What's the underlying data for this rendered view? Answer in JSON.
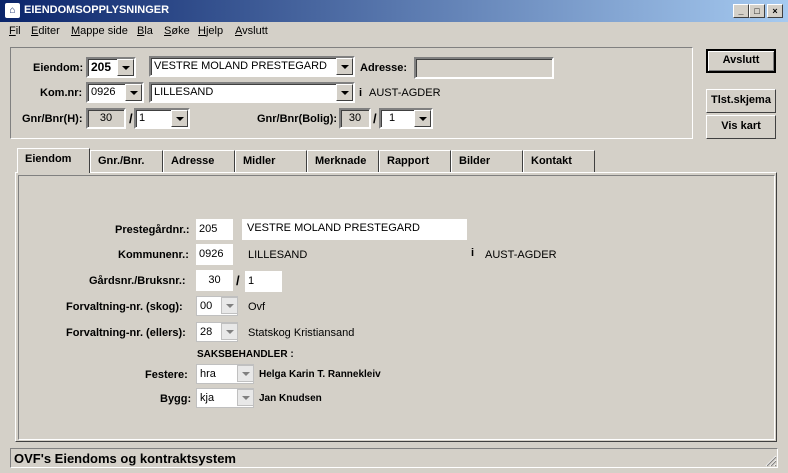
{
  "window": {
    "title": "EIENDOMSOPPLYSNINGER",
    "min_glyph": "_",
    "max_glyph": "□",
    "close_glyph": "×"
  },
  "menu": [
    "Fil",
    "Editer",
    "Mappe side",
    "Bla",
    "Søke",
    "Hjelp",
    "Avslutt"
  ],
  "header": {
    "eiendom_label": "Eiendom:",
    "eiendom_value": "205",
    "eiendom_name": "VESTRE MOLAND PRESTEGARD",
    "adresse_label": "Adresse:",
    "adresse_value": "",
    "komnr_label": "Kom.nr:",
    "komnr_value": "0926",
    "kommune_name": "LILLESAND",
    "info_mark": "i",
    "fylke": "AUST-AGDER",
    "gnrbnr_h_label": "Gnr/Bnr(H):",
    "gnr_h": "30",
    "slash": "/",
    "bnr_h": "1",
    "gnrbnr_bolig_label": "Gnr/Bnr(Bolig):",
    "gnr_bolig": "30",
    "bnr_bolig": "1"
  },
  "buttons": {
    "avslutt": "Avslutt",
    "tlst": "Tlst.skjema",
    "vis_kart": "Vis kart"
  },
  "tabs": [
    "Eiendom",
    "Gnr./Bnr.",
    "Adresse",
    "Midler",
    "Merknade",
    "Rapport",
    "Bilder",
    "Kontakt"
  ],
  "form": {
    "prestegardnr_label": "Prestegårdnr.:",
    "prestegardnr_value": "205",
    "prestegard_name": "VESTRE MOLAND PRESTEGARD",
    "kommunenr_label": "Kommunenr.:",
    "kommunenr_value": "0926",
    "kommune_name": "LILLESAND",
    "info_mark": "i",
    "fylke": "AUST-AGDER",
    "gards_label": "Gårdsnr./Bruksnr.:",
    "gardsnr": "30",
    "slash": "/",
    "bruksnr": "1",
    "forv_skog_label": "Forvaltning-nr. (skog):",
    "forv_skog_value": "00",
    "forv_skog_name": "Ovf",
    "forv_ellers_label": "Forvaltning-nr. (ellers):",
    "forv_ellers_value": "28",
    "forv_ellers_name": "Statskog Kristiansand",
    "saksbehandler_label": "SAKSBEHANDLER :",
    "festere_label": "Festere:",
    "festere_value": "hra",
    "festere_name": "Helga Karin T. Rannekleiv",
    "bygg_label": "Bygg:",
    "bygg_value": "kja",
    "bygg_name": "Jan Knudsen"
  },
  "status": {
    "text": "OVF's Eiendoms og kontraktsystem"
  }
}
